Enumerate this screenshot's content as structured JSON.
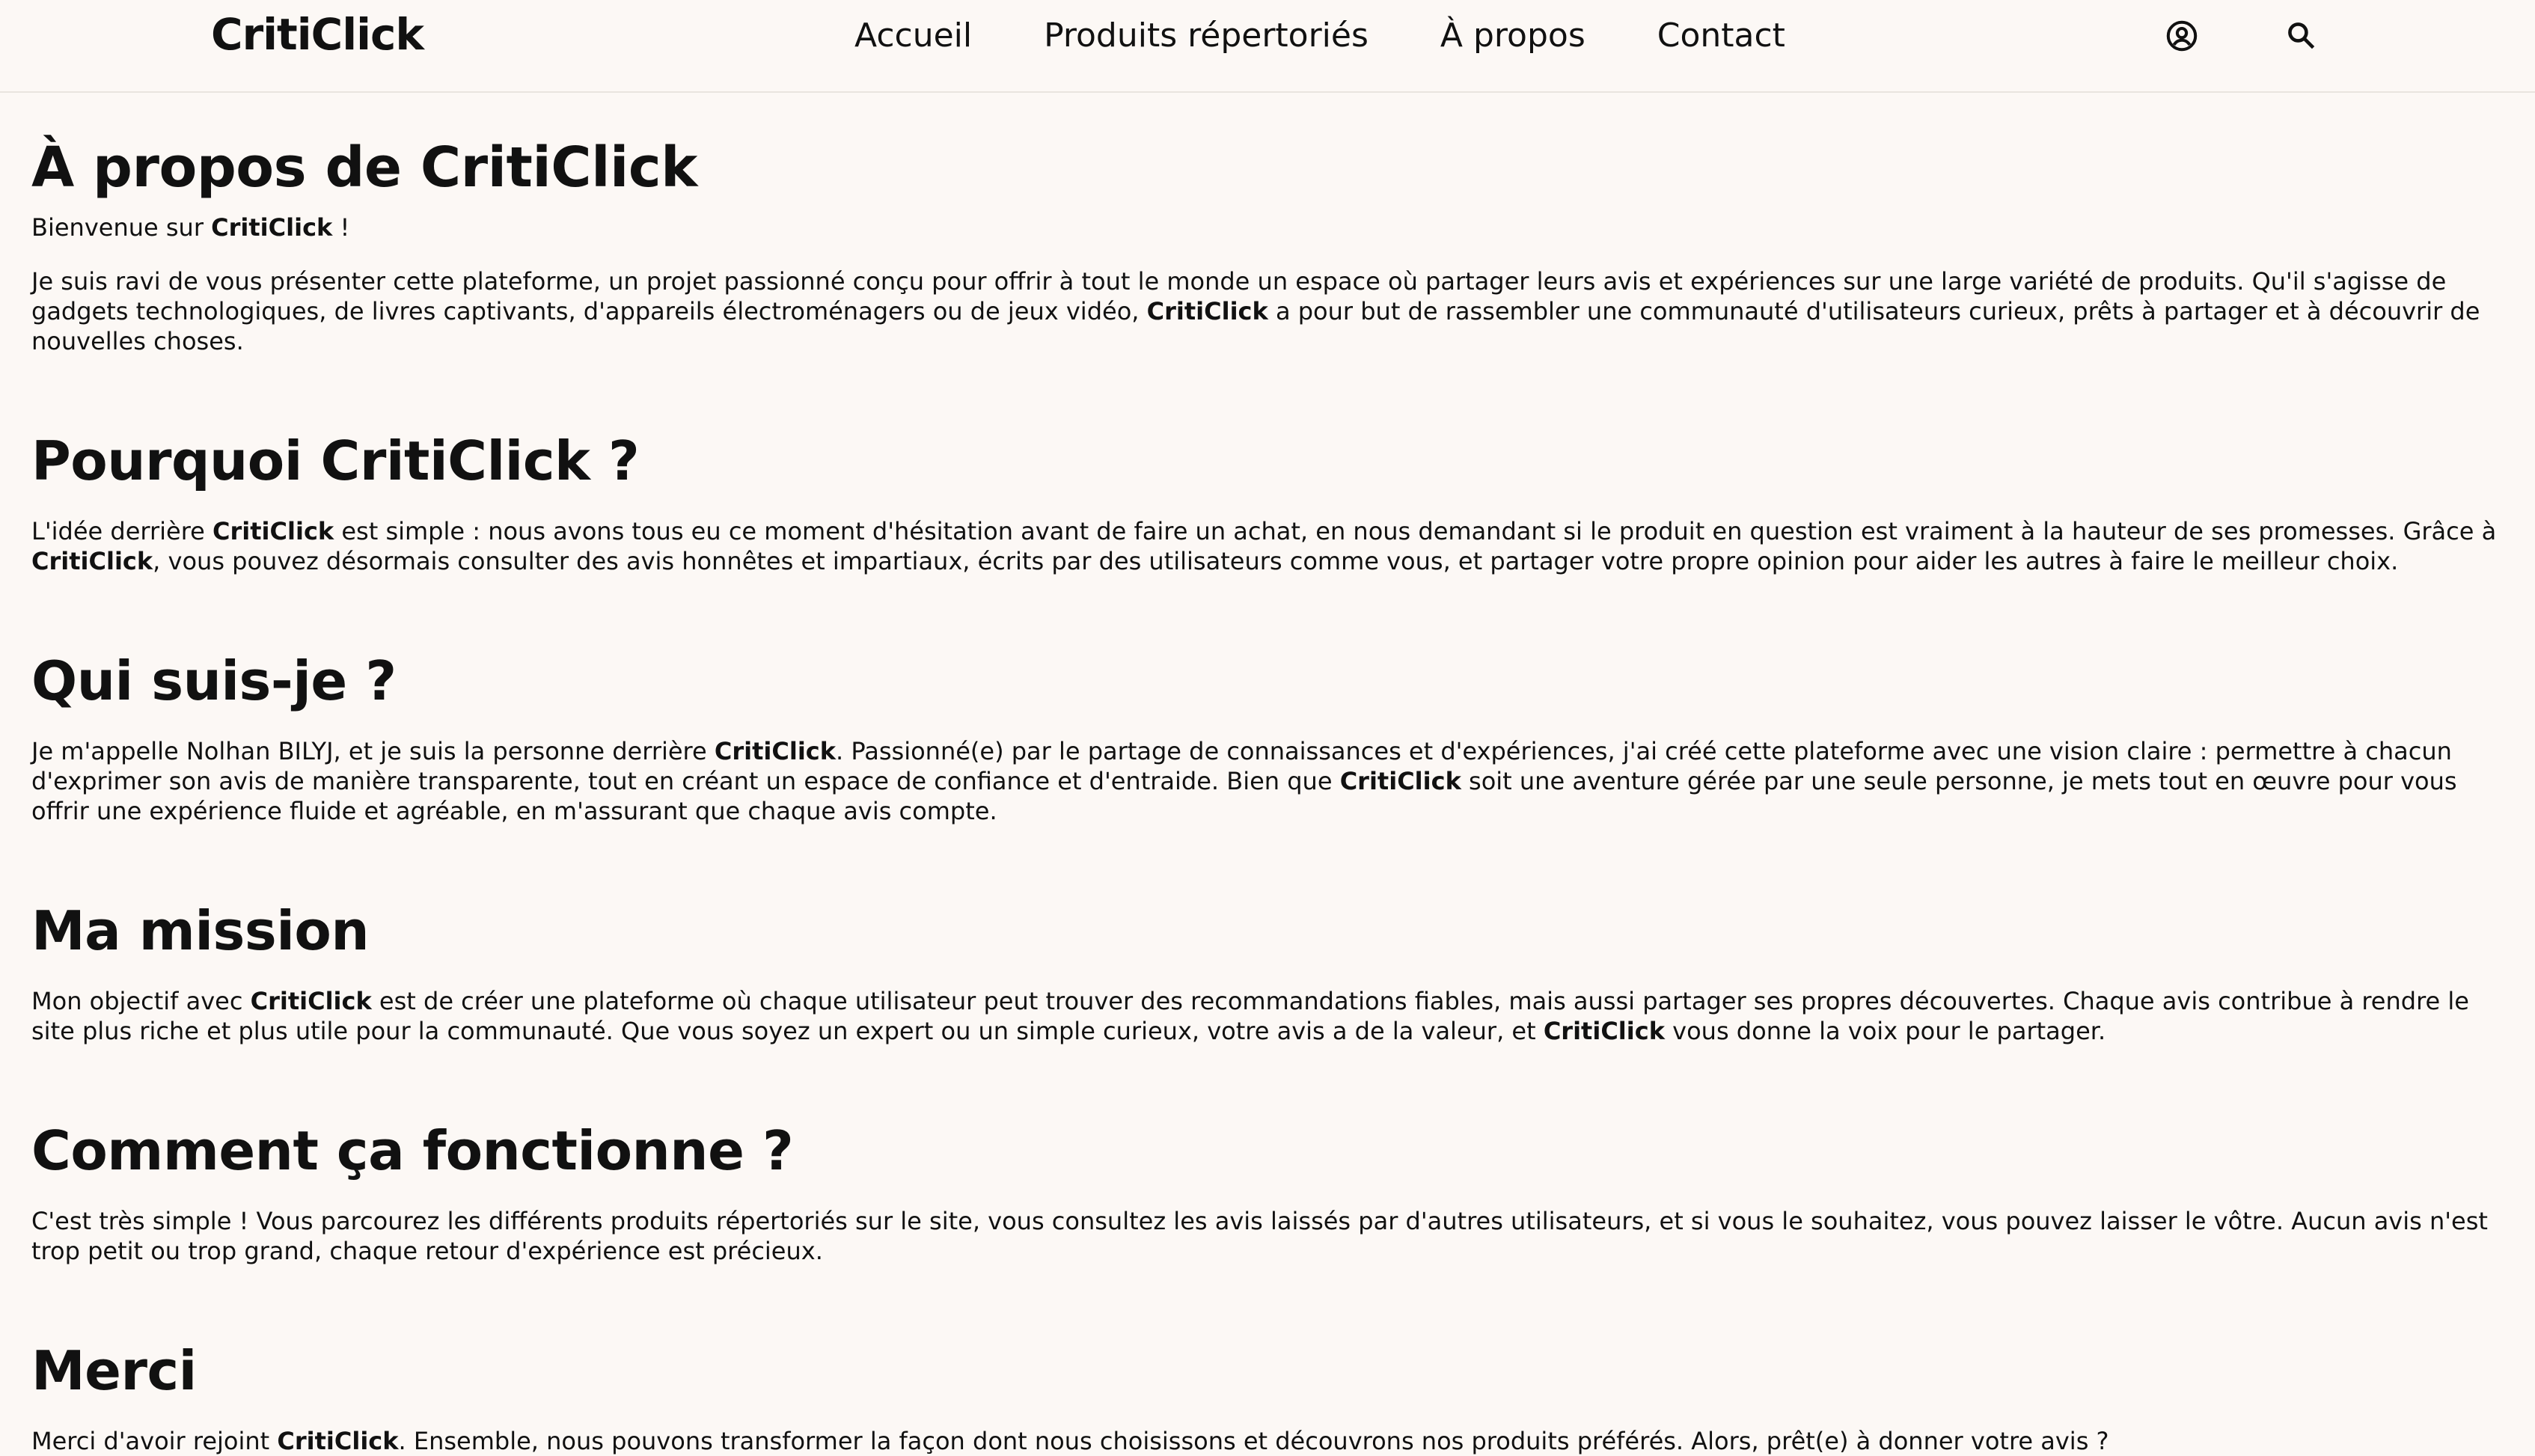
{
  "header": {
    "logo": "CritiClick",
    "nav": [
      "Accueil",
      "Produits répertoriés",
      "À propos",
      "Contact"
    ],
    "icons": [
      "user-icon",
      "search-icon"
    ]
  },
  "page": {
    "title": "À propos de CritiClick",
    "intro": {
      "p1": {
        "a": "Bienvenue sur ",
        "brand": "CritiClick",
        "b": " !"
      },
      "p2": {
        "a": "Je suis ravi de vous présenter cette plateforme, un projet passionné conçu pour offrir à tout le monde un espace où partager leurs avis et expériences sur une large variété de produits. Qu'il s'agisse de gadgets technologiques, de livres captivants, d'appareils électroménagers ou de jeux vidéo, ",
        "brand": "CritiClick",
        "b": " a pour but de rassembler une communauté d'utilisateurs curieux, prêts à partager et à découvrir de nouvelles choses."
      }
    },
    "sections": [
      {
        "heading": "Pourquoi CritiClick ?",
        "a": "L'idée derrière ",
        "brand1": "CritiClick",
        "b": " est simple : nous avons tous eu ce moment d'hésitation avant de faire un achat, en nous demandant si le produit en question est vraiment à la hauteur de ses promesses. Grâce à ",
        "brand2": "CritiClick",
        "c": ", vous pouvez désormais consulter des avis honnêtes et impartiaux, écrits par des utilisateurs comme vous, et partager votre propre opinion pour aider les autres à faire le meilleur choix."
      },
      {
        "heading": "Qui suis-je ?",
        "a": "Je m'appelle Nolhan BILYJ, et je suis la personne derrière ",
        "brand1": "CritiClick",
        "b": ". Passionné(e) par le partage de connaissances et d'expériences, j'ai créé cette plateforme avec une vision claire : permettre à chacun d'exprimer son avis de manière transparente, tout en créant un espace de confiance et d'entraide. Bien que ",
        "brand2": "CritiClick",
        "c": " soit une aventure gérée par une seule personne, je mets tout en œuvre pour vous offrir une expérience fluide et agréable, en m'assurant que chaque avis compte."
      },
      {
        "heading": "Ma mission",
        "a": "Mon objectif avec ",
        "brand1": "CritiClick",
        "b": " est de créer une plateforme où chaque utilisateur peut trouver des recommandations fiables, mais aussi partager ses propres découvertes. Chaque avis contribue à rendre le site plus riche et plus utile pour la communauté. Que vous soyez un expert ou un simple curieux, votre avis a de la valeur, et ",
        "brand2": "CritiClick",
        "c": " vous donne la voix pour le partager."
      },
      {
        "heading": "Comment ça fonctionne ?",
        "a": "C'est très simple ! Vous parcourez les différents produits répertoriés sur le site, vous consultez les avis laissés par d'autres utilisateurs, et si vous le souhaitez, vous pouvez laisser le vôtre. Aucun avis n'est trop petit ou trop grand, chaque retour d'expérience est précieux."
      },
      {
        "heading": "Merci",
        "a": "Merci d'avoir rejoint ",
        "brand1": "CritiClick",
        "b": ". Ensemble, nous pouvons transformer la façon dont nous choisissons et découvrons nos produits préférés. Alors, prêt(e) à donner votre avis ?"
      }
    ]
  }
}
